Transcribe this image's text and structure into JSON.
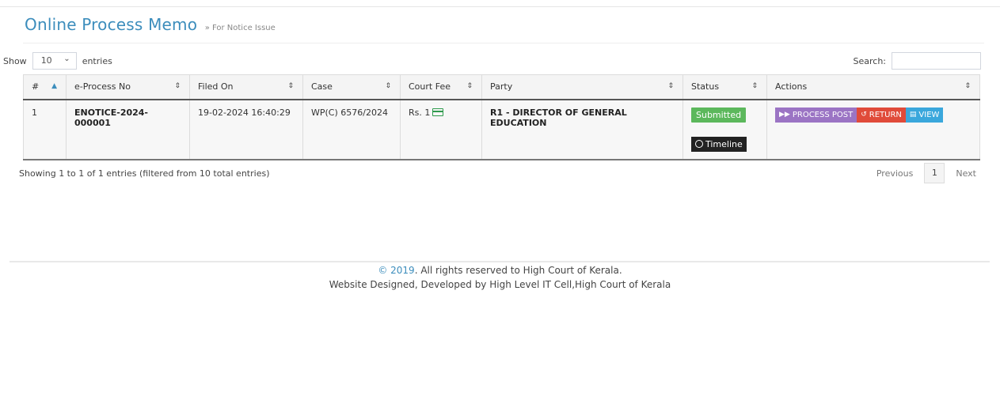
{
  "header": {
    "title": "Online Process Memo",
    "subtitle": "» For Notice Issue"
  },
  "length_control": {
    "show_label": "Show",
    "value": "10",
    "entries_label": "entries"
  },
  "search": {
    "label": "Search:",
    "value": ""
  },
  "table": {
    "columns": [
      "#",
      "e-Process No",
      "Filed On",
      "Case",
      "Court Fee",
      "Party",
      "Status",
      "Actions"
    ],
    "rows": [
      {
        "index": "1",
        "eprocess_no": "ENOTICE-2024-000001",
        "filed_on": "19-02-2024 16:40:29",
        "case": "WP(C) 6576/2024",
        "court_fee": "Rs. 1",
        "party": "R1 - DIRECTOR OF GENERAL EDUCATION",
        "status": "Submitted",
        "timeline_label": "Timeline",
        "actions": {
          "process_post": "PROCESS POST",
          "return": "RETURN",
          "view": "VIEW"
        }
      }
    ]
  },
  "info": "Showing 1 to 1 of 1 entries (filtered from 10 total entries)",
  "pagination": {
    "previous": "Previous",
    "current_page": "1",
    "next": "Next"
  },
  "footer": {
    "copyright_year": "© 2019",
    "rights": ". All rights reserved to High Court of Kerala.",
    "credit": "Website Designed, Developed by High Level IT Cell,High Court of Kerala"
  },
  "colors": {
    "accent": "#3c8dbc",
    "submitted": "#5cb85c",
    "process_post": "#9b74c4",
    "return": "#e04b3a",
    "view": "#3aa7dc"
  },
  "icons": [
    "sort-icon",
    "sort-asc-icon",
    "chevron-down-icon",
    "card-icon",
    "clock-icon",
    "fast-forward-icon",
    "undo-icon",
    "file-icon"
  ]
}
